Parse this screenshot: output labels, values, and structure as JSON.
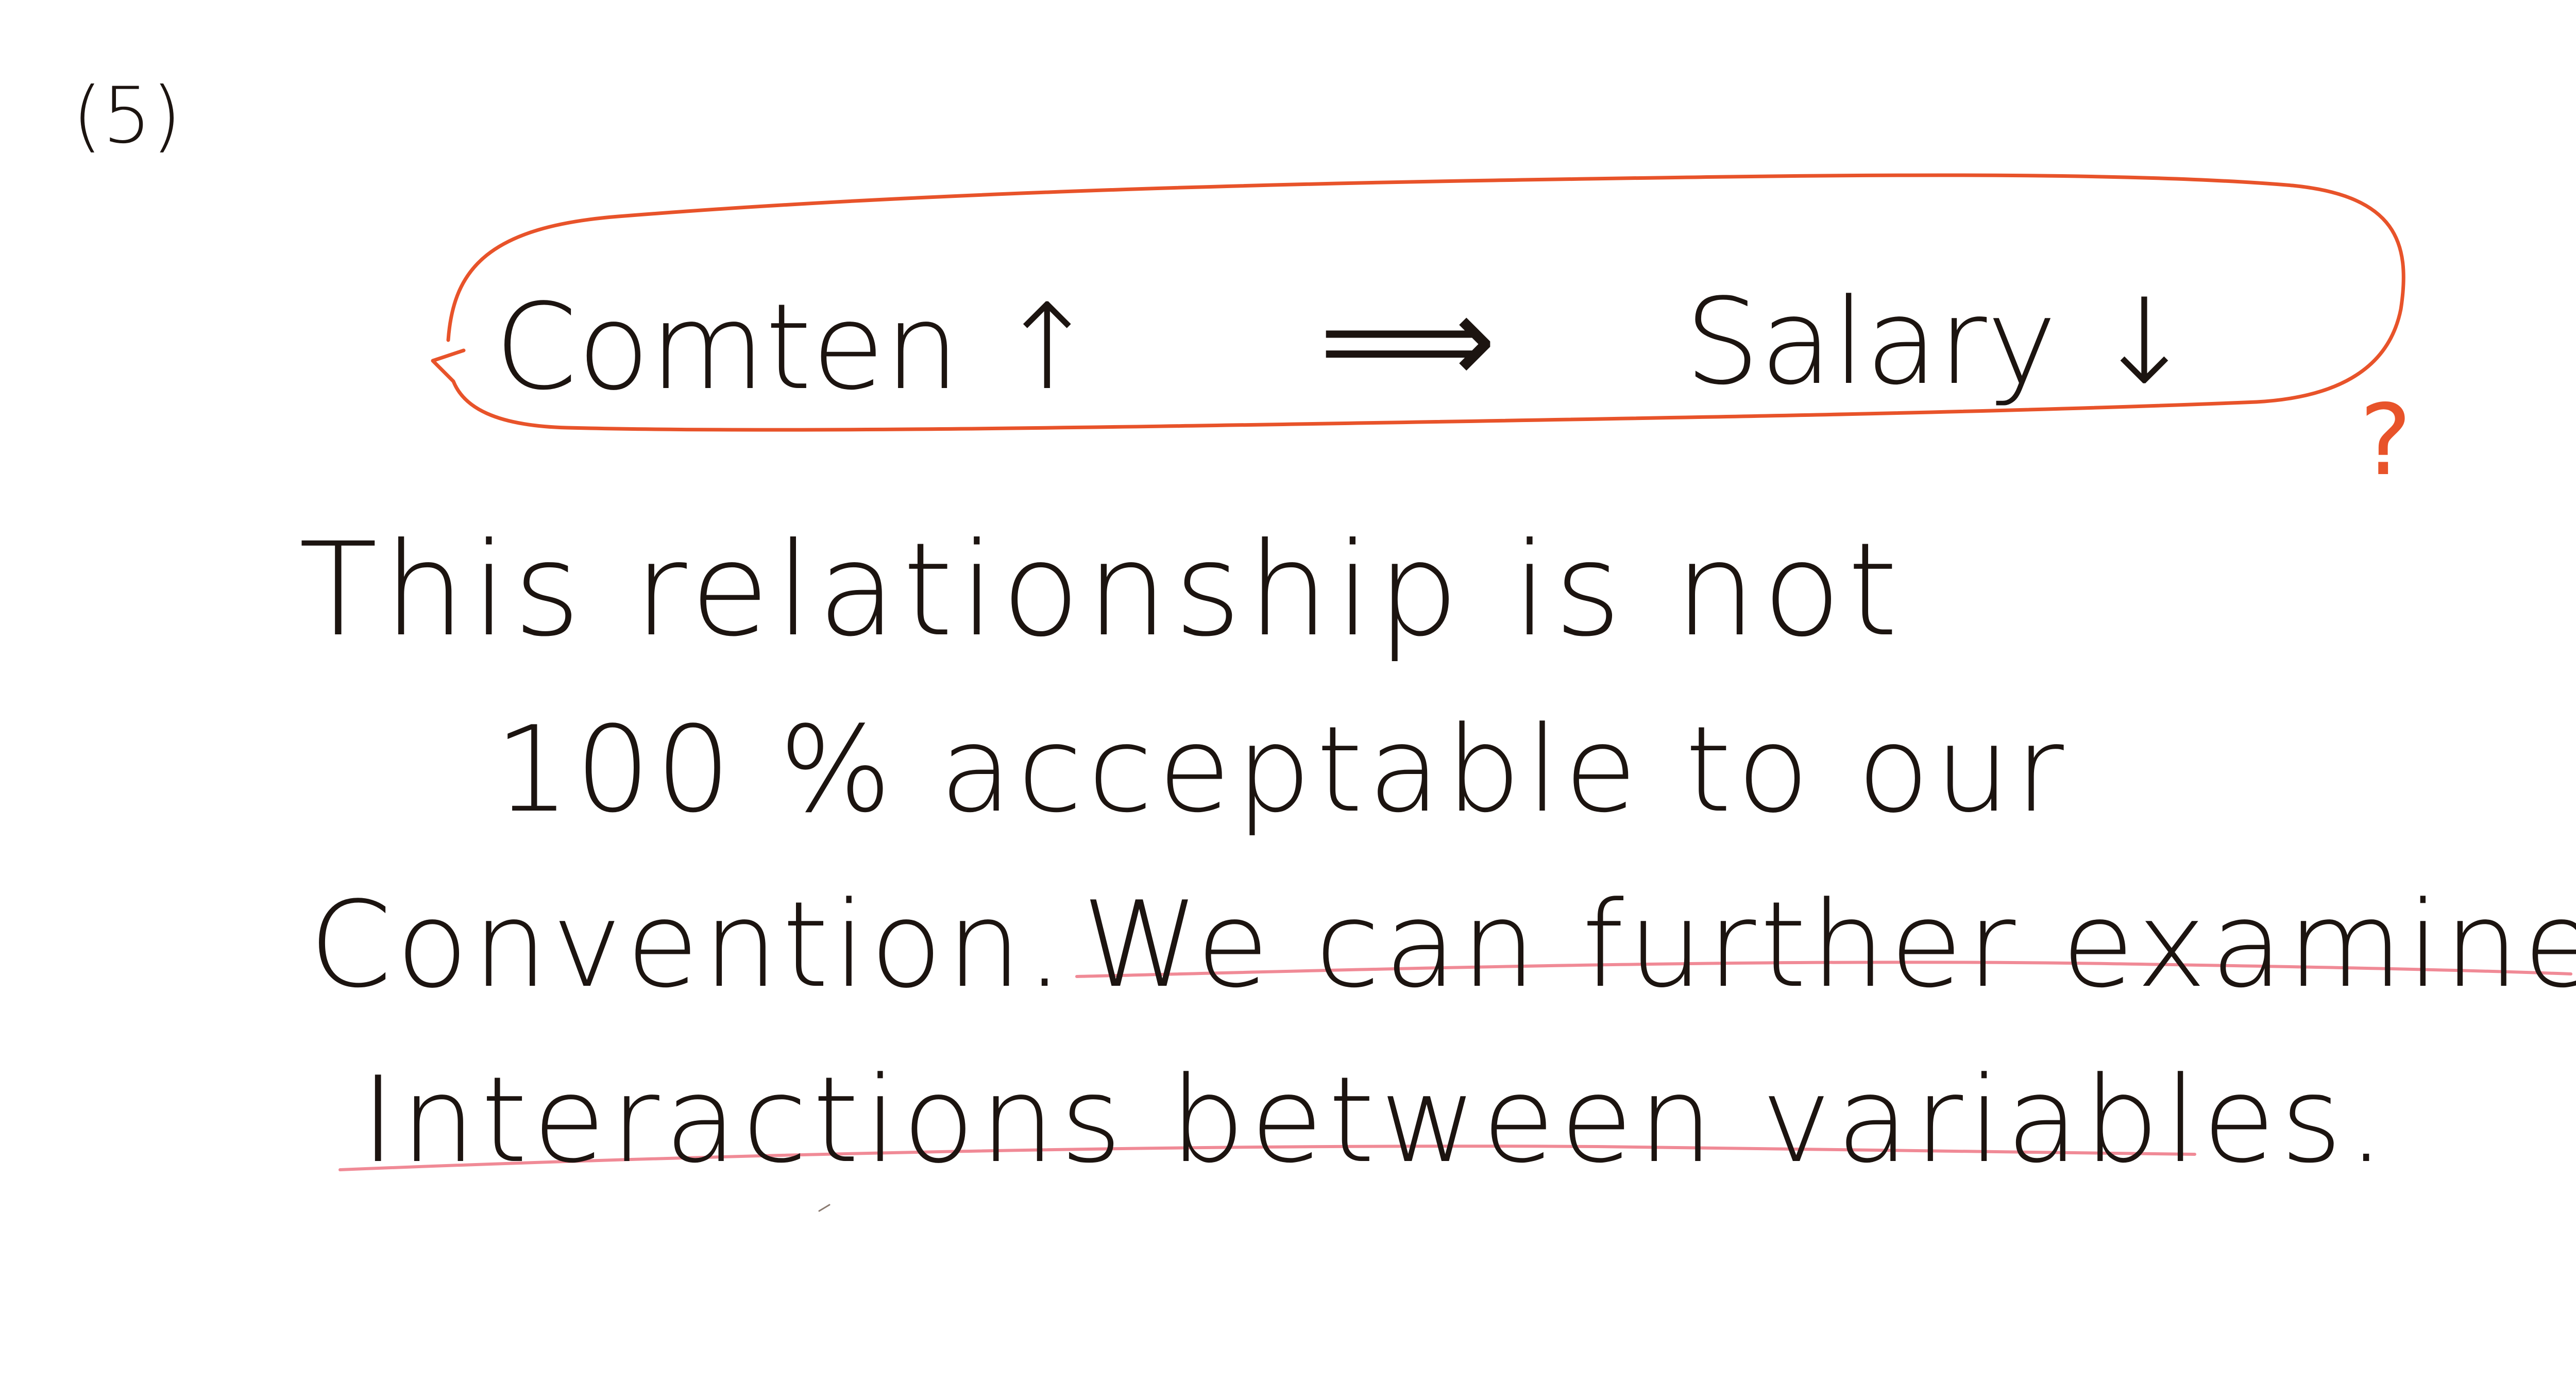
{
  "note": {
    "section_number": "(5)",
    "highlight_box": {
      "left": "Comten ↑",
      "arrow": "⟹",
      "right": "Salary ↓",
      "question_mark": "?"
    },
    "lines": [
      "This relationship is not",
      "100 % acceptable to our",
      "Convention.",
      "We can further examine",
      "Interactions between variables."
    ]
  },
  "colors": {
    "ink": "#1c1410",
    "highlight_box": "#e8532a",
    "underline": "#f08a96"
  }
}
